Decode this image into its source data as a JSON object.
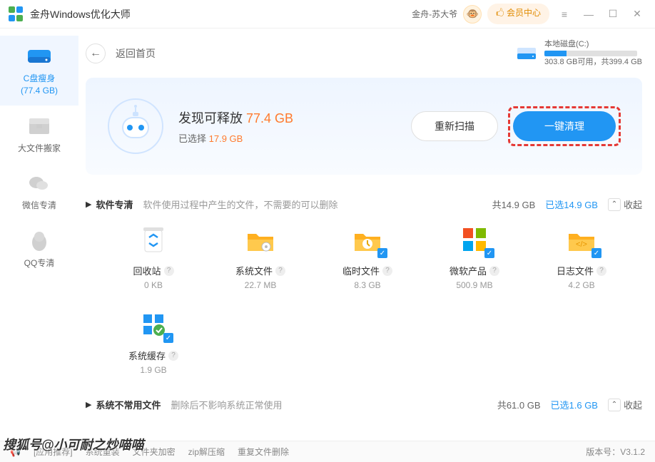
{
  "titlebar": {
    "app_name": "金舟Windows优化大师",
    "user": "金舟-苏大爷",
    "vip": "🖒 会员中心"
  },
  "disk": {
    "name": "本地磁盘(C:)",
    "detail": "303.8 GB可用，共399.4 GB"
  },
  "nav": {
    "back": "返回首页"
  },
  "sidebar": [
    {
      "label": "C盘瘦身\n(77.4 GB)",
      "active": true
    },
    {
      "label": "大文件搬家"
    },
    {
      "label": "微信专清"
    },
    {
      "label": "QQ专清"
    }
  ],
  "scan": {
    "found_prefix": "发现可释放 ",
    "found_amount": "77.4 GB",
    "selected_prefix": "已选择 ",
    "selected_amount": "17.9 GB",
    "rescan": "重新扫描",
    "clean": "一键清理"
  },
  "sections": [
    {
      "title": "软件专清",
      "desc": "软件使用过程中产生的文件，不需要的可以删除",
      "total": "共14.9 GB",
      "selected": "已选14.9 GB",
      "collapse": "收起",
      "items": [
        {
          "name": "回收站",
          "size": "0 KB",
          "checked": false,
          "icon": "recycle"
        },
        {
          "name": "系统文件",
          "size": "22.7 MB",
          "checked": false,
          "icon": "folder-gear"
        },
        {
          "name": "临时文件",
          "size": "8.3 GB",
          "checked": true,
          "icon": "folder-clock"
        },
        {
          "name": "微软产品",
          "size": "500.9 MB",
          "checked": true,
          "icon": "microsoft"
        },
        {
          "name": "日志文件",
          "size": "4.2 GB",
          "checked": true,
          "icon": "folder-code"
        },
        {
          "name": "系统缓存",
          "size": "1.9 GB",
          "checked": true,
          "icon": "win-cache"
        }
      ]
    },
    {
      "title": "系统不常用文件",
      "desc": "删除后不影响系统正常使用",
      "total": "共61.0 GB",
      "selected": "已选1.6 GB",
      "collapse": "收起"
    }
  ],
  "footer": {
    "links": [
      "[应用推荐]",
      "系统重装",
      "文件夹加密",
      "zip解压缩",
      "重复文件删除"
    ],
    "version": "版本号：V3.1.2"
  },
  "watermark": "搜狐号@小可耐之炒喵喵"
}
